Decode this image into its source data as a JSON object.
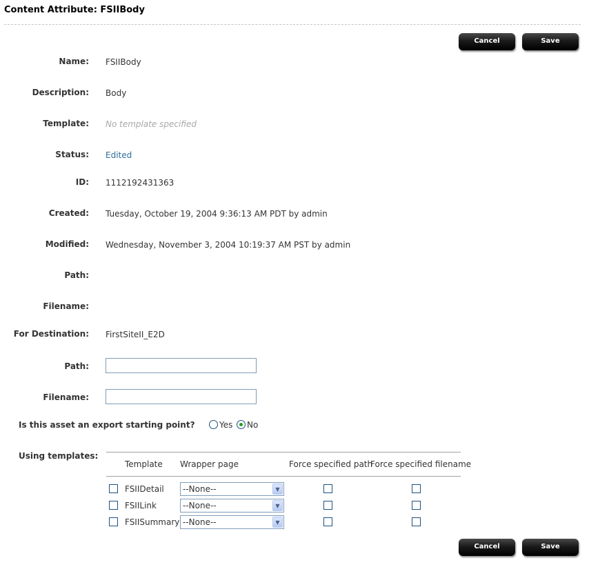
{
  "page": {
    "title": "Content Attribute: FSIIBody"
  },
  "buttons": {
    "cancel": "Cancel",
    "save": "Save"
  },
  "fields": {
    "name": {
      "label": "Name:",
      "value": "FSIIBody"
    },
    "description": {
      "label": "Description:",
      "value": "Body"
    },
    "template": {
      "label": "Template:",
      "value": "No template specified"
    },
    "status": {
      "label": "Status:",
      "value": "Edited"
    },
    "id": {
      "label": "ID:",
      "value": "1112192431363"
    },
    "created": {
      "label": "Created:",
      "value": "Tuesday, October 19, 2004 9:36:13 AM PDT by admin"
    },
    "modified": {
      "label": "Modified:",
      "value": "Wednesday, November 3, 2004 10:19:37 AM PST by admin"
    },
    "path": {
      "label": "Path:",
      "value": ""
    },
    "filename": {
      "label": "Filename:",
      "value": ""
    },
    "destination": {
      "label": "For Destination:",
      "value": "FirstSiteII_E2D"
    },
    "dest_path": {
      "label": "Path:",
      "value": ""
    },
    "dest_filename": {
      "label": "Filename:",
      "value": ""
    }
  },
  "export_start": {
    "question": "Is this asset an export starting point?",
    "options": [
      "Yes",
      "No"
    ],
    "selected": "No"
  },
  "templates": {
    "label": "Using templates:",
    "columns": [
      "Template",
      "Wrapper page",
      "Force specified path",
      "Force specified filename"
    ],
    "rows": [
      {
        "name": "FSIIDetail",
        "wrapper": "--None--",
        "checked": false,
        "force_path": false,
        "force_filename": false
      },
      {
        "name": "FSIILink",
        "wrapper": "--None--",
        "checked": false,
        "force_path": false,
        "force_filename": false
      },
      {
        "name": "FSIISummary",
        "wrapper": "--None--",
        "checked": false,
        "force_path": false,
        "force_filename": false
      }
    ]
  },
  "icons": {
    "dropdown": "chevron-down-icon"
  },
  "colors": {
    "status_link": "#2e6e9e",
    "button_bg": "#000000",
    "radio_selected": "#21a121"
  }
}
